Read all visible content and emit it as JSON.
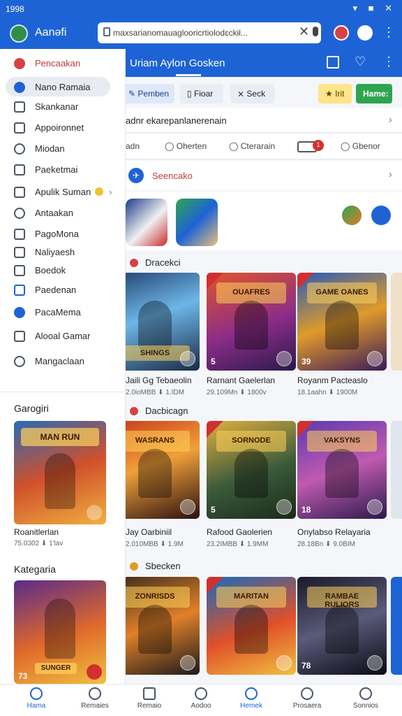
{
  "status_bar": {
    "time": "1998",
    "icons": "▾ ■ ✕"
  },
  "app_bar": {
    "app_name": "Aanəfi",
    "url": "maxsarianomauaglooricrtiolodɛckɨl...",
    "close_glyph": "✕",
    "more_glyph": "⋮"
  },
  "page_header": {
    "title": "Uriam Aylon Gosken",
    "icon2": "♡",
    "icon3": "⋮"
  },
  "chips": {
    "c1": "✎ Pemben",
    "c2": "▯ Fioar",
    "c3": "⨯ Seck",
    "c4": "★ Irit",
    "c5": "Hame:"
  },
  "notice": {
    "text": "adnr ekarepanlanerenain",
    "chev": "›"
  },
  "filters": {
    "f1": "adn",
    "f2": "◯ Oherten",
    "f3": "◯ Cterarain",
    "f4": "1",
    "f5": "◯ Gbenor"
  },
  "section": {
    "icon": "✈",
    "title": "Seencako",
    "chev": "›"
  },
  "shelves": [
    {
      "title": "Dracekci",
      "cards": [
        {
          "name": "Jaili Gg Tebaeolin",
          "meta": "2.0ioMBB  ⬇ 1.IDM",
          "logo": "SHINGS",
          "num": ""
        },
        {
          "name": "Rarnant Gaelerlan",
          "meta": "29.109Mn  ⬇ 1800v",
          "logo": "OUAFRES",
          "num": "5"
        },
        {
          "name": "Royanm Pacteaslo",
          "meta": "18.1aahn  ⬇ 1900M",
          "logo": "GAME OANES",
          "num": "39"
        }
      ]
    },
    {
      "title": "Dacbicagn",
      "cards": [
        {
          "name": "Jay Oarbiniil",
          "meta": "2.010MBB  ⬇ 1.9M",
          "logo": "WASRANS",
          "num": ""
        },
        {
          "name": "Rafood Gaolerien",
          "meta": "23.2IMBB  ⬇ 1.9MM",
          "logo": "SORNODE",
          "num": "5"
        },
        {
          "name": "Onylabso Relayaria",
          "meta": "28.18Bn  ⬇ 9.0BIM",
          "logo": "VAKSYNS",
          "num": "18"
        }
      ]
    },
    {
      "title": "Sbecken",
      "cards": [
        {
          "name": "",
          "meta": "",
          "logo": "ZONRISDS",
          "num": ""
        },
        {
          "name": "",
          "meta": "",
          "logo": "MARITAN",
          "num": ""
        },
        {
          "name": "",
          "meta": "",
          "logo": "RAMBAE RULIORS",
          "num": "78"
        }
      ]
    }
  ],
  "drawer": {
    "items": [
      "Pencaakan",
      "Nano Ramaia",
      "Skankanar",
      "Appoironnet",
      "Miodan",
      "Paeketmai",
      "Apulik Suman",
      "Antaakan",
      "PagoMona",
      "Naliyaesh",
      "Boedok",
      "Paedenan",
      "PacaMema",
      "Alooal Gamar",
      "Mangaclaan"
    ],
    "apulik_chev": "›",
    "groups": [
      {
        "title": "Garogiri",
        "card_logo": "MAN RUN",
        "card_name": "Roanitlerlan",
        "card_meta": "75.0302  ⬇ 1'lav",
        "num": ""
      },
      {
        "title": "Kategaria",
        "card_logo": "SUNGER",
        "num": "73"
      }
    ]
  },
  "bottom_nav": [
    "Hama",
    "Remaies",
    "Remaio",
    "Aodoo",
    "Hemek",
    "Prosaera",
    "Sonnios"
  ]
}
